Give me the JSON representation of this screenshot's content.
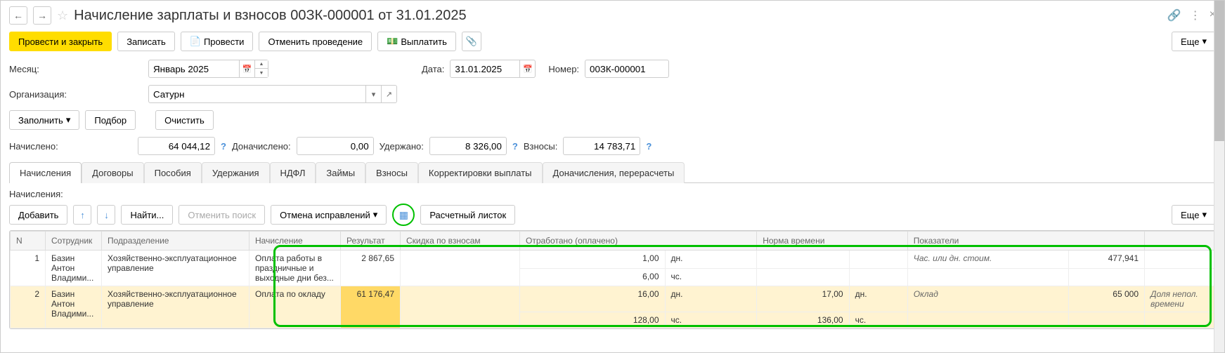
{
  "title": "Начисление зарплаты и взносов 00ЗК-000001 от 31.01.2025",
  "toolbar": {
    "post_and_close": "Провести и закрыть",
    "save": "Записать",
    "post": "Провести",
    "cancel_post": "Отменить проведение",
    "pay": "Выплатить",
    "more": "Еще"
  },
  "fields": {
    "month_label": "Месяц:",
    "month_value": "Январь 2025",
    "date_label": "Дата:",
    "date_value": "31.01.2025",
    "number_label": "Номер:",
    "number_value": "00ЗК-000001",
    "org_label": "Организация:",
    "org_value": "Сатурн"
  },
  "actions": {
    "fill": "Заполнить",
    "select": "Подбор",
    "clear": "Очистить"
  },
  "totals": {
    "accrued_label": "Начислено:",
    "accrued_value": "64 044,12",
    "extra_label": "Доначислено:",
    "extra_value": "0,00",
    "withheld_label": "Удержано:",
    "withheld_value": "8 326,00",
    "contrib_label": "Взносы:",
    "contrib_value": "14 783,71"
  },
  "tabs": [
    "Начисления",
    "Договоры",
    "Пособия",
    "Удержания",
    "НДФЛ",
    "Займы",
    "Взносы",
    "Корректировки выплаты",
    "Доначисления, перерасчеты"
  ],
  "sub_label": "Начисления:",
  "table_toolbar": {
    "add": "Добавить",
    "find": "Найти...",
    "cancel_find": "Отменить поиск",
    "cancel_fix": "Отмена исправлений",
    "payslip": "Расчетный листок",
    "more": "Еще"
  },
  "columns": {
    "n": "N",
    "employee": "Сотрудник",
    "department": "Подразделение",
    "accrual": "Начисление",
    "result": "Результат",
    "discount": "Скидка по взносам",
    "worked": "Отработано (оплачено)",
    "norm": "Норма времени",
    "indicators": "Показатели"
  },
  "rows": [
    {
      "n": "1",
      "employee": "Базин Антон Владими...",
      "department": "Хозяйственно-эксплуатационное управление",
      "accrual": "Оплата работы в праздничные и выходные дни без...",
      "result": "2 867,65",
      "worked_days": "1,00",
      "worked_days_unit": "дн.",
      "worked_hours": "6,00",
      "worked_hours_unit": "чс.",
      "norm_days": "",
      "norm_hours": "",
      "indicator_label": "Час. или дн. стоим.",
      "indicator_value": "477,941",
      "extra_indicator": ""
    },
    {
      "n": "2",
      "employee": "Базин Антон Владими...",
      "department": "Хозяйственно-эксплуатационное управление",
      "accrual": "Оплата по окладу",
      "result": "61 176,47",
      "worked_days": "16,00",
      "worked_days_unit": "дн.",
      "worked_hours": "128,00",
      "worked_hours_unit": "чс.",
      "norm_days": "17,00",
      "norm_days_unit": "дн.",
      "norm_hours": "136,00",
      "norm_hours_unit": "чс.",
      "indicator_label": "Оклад",
      "indicator_value": "65 000",
      "extra_indicator": "Доля непол. времени"
    }
  ]
}
